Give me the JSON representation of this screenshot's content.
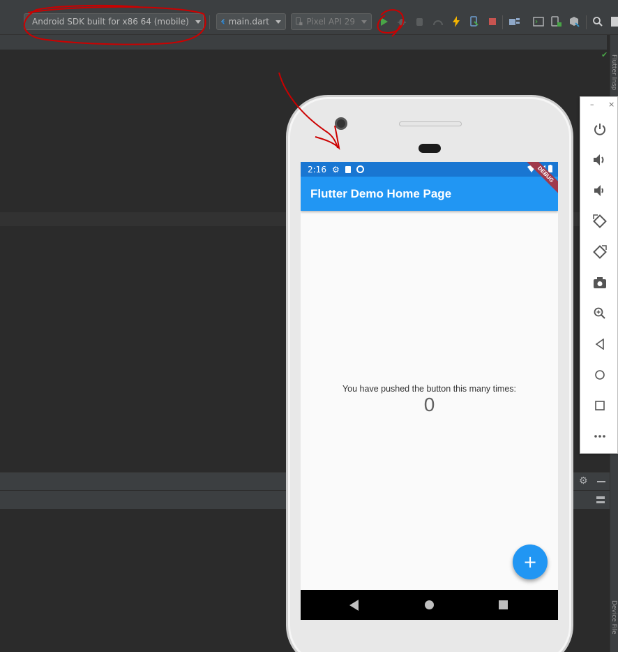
{
  "ide": {
    "device_selector": "Android SDK built for x86 64 (mobile)",
    "run_config": "main.dart",
    "emulator_selector": "Pixel API 29",
    "right_stripe_top": "Flutter Insp",
    "right_stripe_bottom": "Device File"
  },
  "toolbar_icons": [
    "run-icon",
    "debug-icon",
    "attach-icon",
    "profile-icon",
    "hot-reload-icon",
    "apply-changes-icon",
    "stop-icon",
    "project-structure-icon",
    "terminal-icon",
    "device-manager-icon",
    "sdk-manager-icon",
    "search-icon"
  ],
  "phone": {
    "status_time": "2:16",
    "app_title": "Flutter Demo Home Page",
    "debug_banner": "DEBUG",
    "counter_label": "You have pushed the button this many times:",
    "counter_value": "0",
    "fab_label": "+"
  },
  "emulator_panel": {
    "minimize": "–",
    "close": "×",
    "buttons": [
      "power-icon",
      "volume-up-icon",
      "volume-down-icon",
      "rotate-left-icon",
      "rotate-right-icon",
      "camera-icon",
      "zoom-icon",
      "back-icon",
      "home-icon",
      "overview-icon",
      "more-icon"
    ]
  },
  "colors": {
    "app_bar": "#2196f3",
    "status_bar": "#1976d2",
    "annotation": "#cc0000"
  }
}
